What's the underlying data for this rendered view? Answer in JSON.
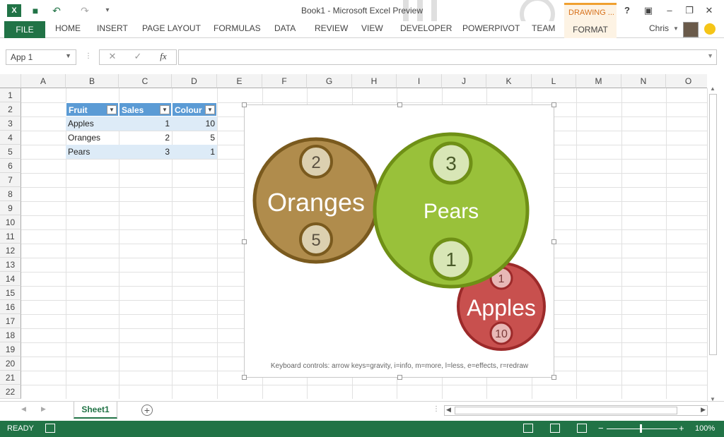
{
  "window": {
    "title": "Book1 - Microsoft Excel Preview",
    "contextual_group": "DRAWING ...",
    "help": "?"
  },
  "ribbon": {
    "file": "FILE",
    "tabs": [
      "HOME",
      "INSERT",
      "PAGE LAYOUT",
      "FORMULAS",
      "DATA",
      "REVIEW",
      "VIEW",
      "DEVELOPER",
      "POWERPIVOT",
      "TEAM"
    ],
    "format": "FORMAT",
    "user": "Chris"
  },
  "formula_bar": {
    "name_box": "App 1",
    "fx": "fx",
    "cancel": "✕",
    "enter": "✓"
  },
  "columns": [
    "A",
    "B",
    "C",
    "D",
    "E",
    "F",
    "G",
    "H",
    "I",
    "J",
    "K",
    "L",
    "M",
    "N",
    "O"
  ],
  "rows": [
    "1",
    "2",
    "3",
    "4",
    "5",
    "6",
    "7",
    "8",
    "9",
    "10",
    "11",
    "12",
    "13",
    "14",
    "15",
    "16",
    "17",
    "18",
    "19",
    "20",
    "21",
    "22"
  ],
  "table": {
    "headers": [
      "Fruit",
      "Sales",
      "Colour"
    ],
    "rows": [
      [
        "Apples",
        "1",
        "10"
      ],
      [
        "Oranges",
        "2",
        "5"
      ],
      [
        "Pears",
        "3",
        "1"
      ]
    ]
  },
  "bubble_app": {
    "bubbles": [
      {
        "label": "Oranges",
        "sales": "2",
        "colour": "5",
        "fill": "#b08c4c",
        "stroke": "#7a5a1e",
        "inner": "#dcd0b0"
      },
      {
        "label": "Pears",
        "sales": "3",
        "colour": "1",
        "fill": "#99c13a",
        "stroke": "#6f9016",
        "inner": "#d8e6b6"
      },
      {
        "label": "Apples",
        "sales": "1",
        "colour": "10",
        "fill": "#c8504e",
        "stroke": "#9c2a2a",
        "inner": "#e8b8b6"
      }
    ],
    "footer": "Keyboard controls: arrow keys=gravity, i=info, m=more, l=less, e=effects, r=redraw"
  },
  "sheets": {
    "active": "Sheet1",
    "add": "+"
  },
  "status": {
    "mode": "READY",
    "zoom": "100%",
    "minus": "−",
    "plus": "+"
  }
}
